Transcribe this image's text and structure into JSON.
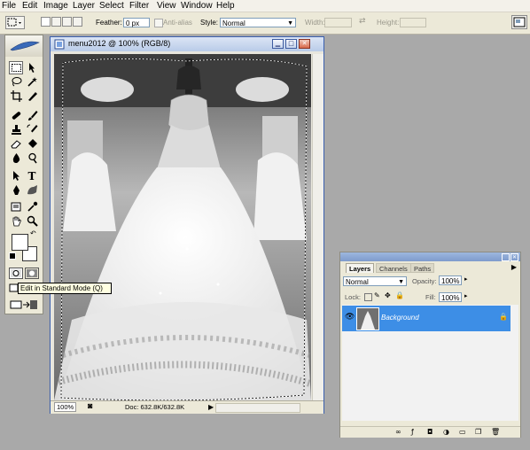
{
  "menu": [
    "File",
    "Edit",
    "Image",
    "Layer",
    "Select",
    "Filter",
    "View",
    "Window",
    "Help"
  ],
  "options": {
    "feather_label": "Feather:",
    "feather_value": "0 px",
    "antialias_label": "Anti-alias",
    "style_label": "Style:",
    "style_value": "Normal",
    "width_label": "Width:",
    "height_label": "Height:"
  },
  "document": {
    "title": "menu2012 @ 100% (RGB/8)",
    "zoom": "100%",
    "doc_info": "Doc: 632.8K/632.8K"
  },
  "tooltip": "Edit in Standard Mode (Q)",
  "layers_panel": {
    "tabs": [
      "Layers",
      "Channels",
      "Paths"
    ],
    "blend_mode": "Normal",
    "opacity_label": "Opacity:",
    "opacity_value": "100%",
    "lock_label": "Lock:",
    "fill_label": "Fill:",
    "fill_value": "100%",
    "layers": [
      {
        "name": "Background",
        "selected": true,
        "locked": true
      }
    ]
  },
  "colors": {
    "workspace": "#a9a9a9",
    "selection": "#3d8ee6",
    "panel": "#ece9d8"
  }
}
